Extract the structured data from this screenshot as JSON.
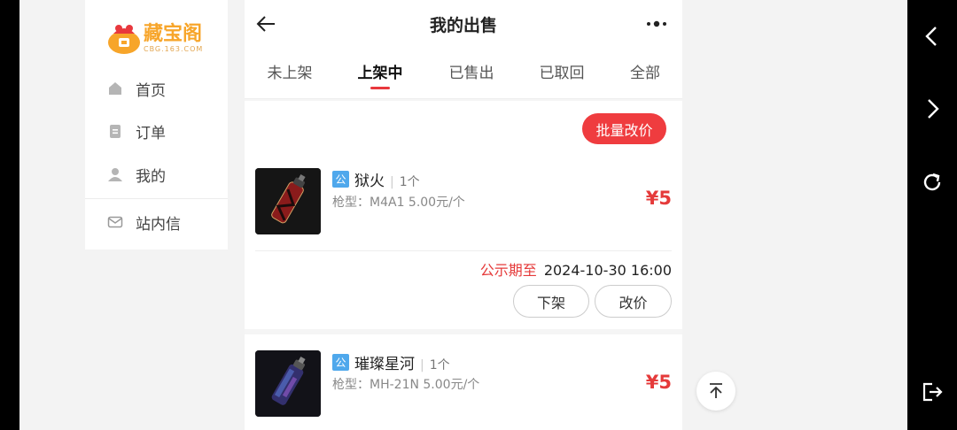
{
  "sidebar": {
    "logo_text": "藏宝阁",
    "logo_sub": "CBG.163.COM",
    "items": [
      {
        "label": "首页",
        "icon": "home-icon"
      },
      {
        "label": "订单",
        "icon": "order-icon"
      },
      {
        "label": "我的",
        "icon": "user-icon"
      },
      {
        "label": "站内信",
        "icon": "mail-icon"
      }
    ]
  },
  "header": {
    "title": "我的出售",
    "tabs": [
      {
        "label": "未上架",
        "active": false
      },
      {
        "label": "上架中",
        "active": true
      },
      {
        "label": "已售出",
        "active": false
      },
      {
        "label": "已取回",
        "active": false
      },
      {
        "label": "全部",
        "active": false
      }
    ]
  },
  "batch_price_label": "批量改价",
  "items": [
    {
      "badge": "公",
      "name": "狱火",
      "qty": "1个",
      "sub": "枪型：M4A1  5.00元/个",
      "price": "¥5",
      "expire_label": "公示期至",
      "expire_time": "2024-10-30 16:00",
      "btn_delist": "下架",
      "btn_reprice": "改价"
    },
    {
      "badge": "公",
      "name": "璀璨星河",
      "qty": "1个",
      "sub": "枪型：MH-21N  5.00元/个",
      "price": "¥5"
    }
  ],
  "colors": {
    "accent": "#ef3c3f",
    "price": "#e53a3a",
    "badge": "#4fa8ec",
    "logo": "#f7a52a"
  }
}
